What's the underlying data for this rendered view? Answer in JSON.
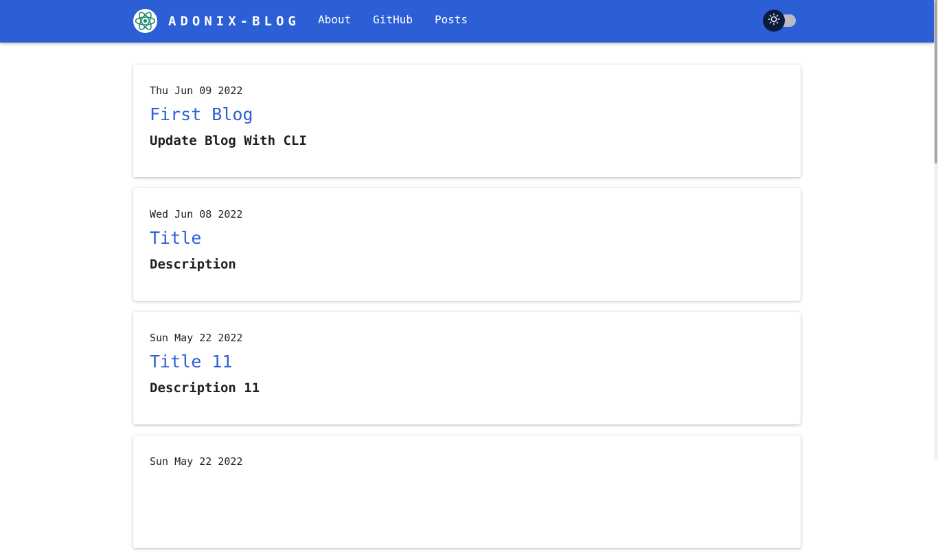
{
  "nav": {
    "brand": "ADONIX-BLOG",
    "logo_icon": "atom-icon",
    "links": [
      {
        "label": "About"
      },
      {
        "label": "GitHub"
      },
      {
        "label": "Posts"
      }
    ],
    "theme_toggle": {
      "icon": "sun-icon",
      "state": "light"
    }
  },
  "colors": {
    "primary": "#2c5fd6",
    "toggle_knob": "#0c1a3d",
    "text": "#1f1f1f"
  },
  "posts": [
    {
      "date": "Thu Jun 09 2022",
      "title": "First Blog",
      "description": "Update Blog With CLI"
    },
    {
      "date": "Wed Jun 08 2022",
      "title": "Title",
      "description": "Description"
    },
    {
      "date": "Sun May 22 2022",
      "title": "Title 11",
      "description": "Description 11"
    },
    {
      "date": "Sun May 22 2022",
      "title": "",
      "description": ""
    }
  ]
}
